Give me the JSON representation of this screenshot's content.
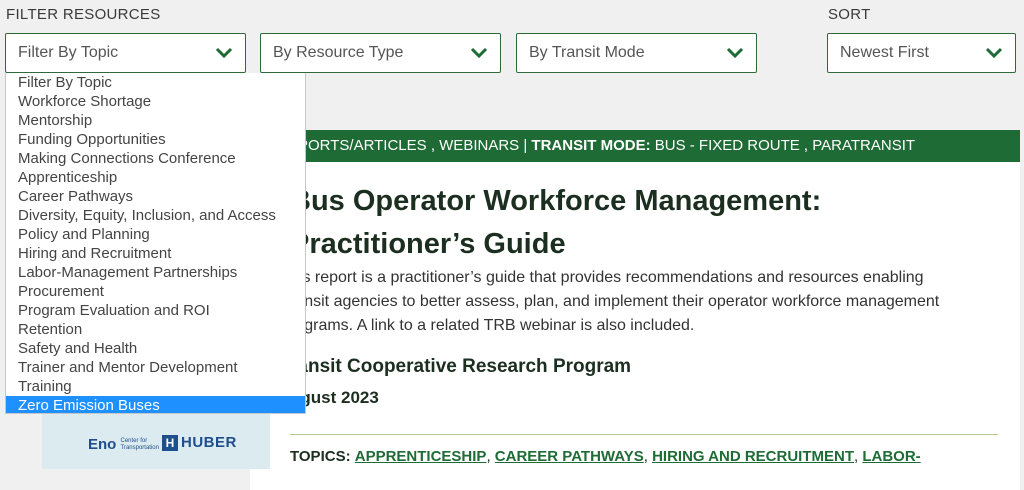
{
  "filter": {
    "section_label": "FILTER RESOURCES",
    "topic_select": "Filter By Topic",
    "type_select": "By Resource Type",
    "mode_select": "By Transit Mode"
  },
  "sort": {
    "section_label": "SORT",
    "select": "Newest First"
  },
  "dropdown": {
    "options": [
      "Filter By Topic",
      "Workforce Shortage",
      "Mentorship",
      "Funding Opportunities",
      "Making Connections Conference",
      "Apprenticeship",
      "Career Pathways",
      "Diversity, Equity, Inclusion, and Access",
      "Policy and Planning",
      "Hiring and Recruitment",
      "Labor-Management Partnerships",
      "Procurement",
      "Program Evaluation and ROI",
      "Retention",
      "Safety and Health",
      "Trainer and Mentor Development",
      "Training",
      "Zero Emission Buses"
    ],
    "selected_index": 17
  },
  "card": {
    "header_type_values": "PORTS/ARTICLES , WEBINARS |",
    "header_mode_label": "TRANSIT MODE:",
    "header_mode_values": "BUS - FIXED ROUTE , PARATRANSIT",
    "title_line1": "Bus Operator Workforce Management:",
    "title_line2": "Practitioner’s Guide",
    "desc_line1": "his report is a practitioner’s guide that provides recommendations and resources enabling",
    "desc_line2": "ransit agencies to better assess, plan, and implement their operator workforce management",
    "desc_line3": "rograms. A link to a related TRB webinar is also included.",
    "organization": "ransit Cooperative Research Program",
    "date": "ugust 2023",
    "topics_label": "TOPICS:",
    "topics": [
      "APPRENTICESHIP",
      "CAREER PATHWAYS",
      "HIRING AND RECRUITMENT",
      "LABOR-"
    ],
    "thumb_logo_eno": "Eno",
    "thumb_logo_eno_sub1": "Center for",
    "thumb_logo_eno_sub2": "Transportation",
    "thumb_logo_huber_mark": "H",
    "thumb_logo_huber": "HUBER"
  },
  "colors": {
    "brand_green": "#1f6b35",
    "selection_blue": "#1e90ff"
  },
  "icons": {
    "select_chevron": "chevron-down-icon"
  }
}
